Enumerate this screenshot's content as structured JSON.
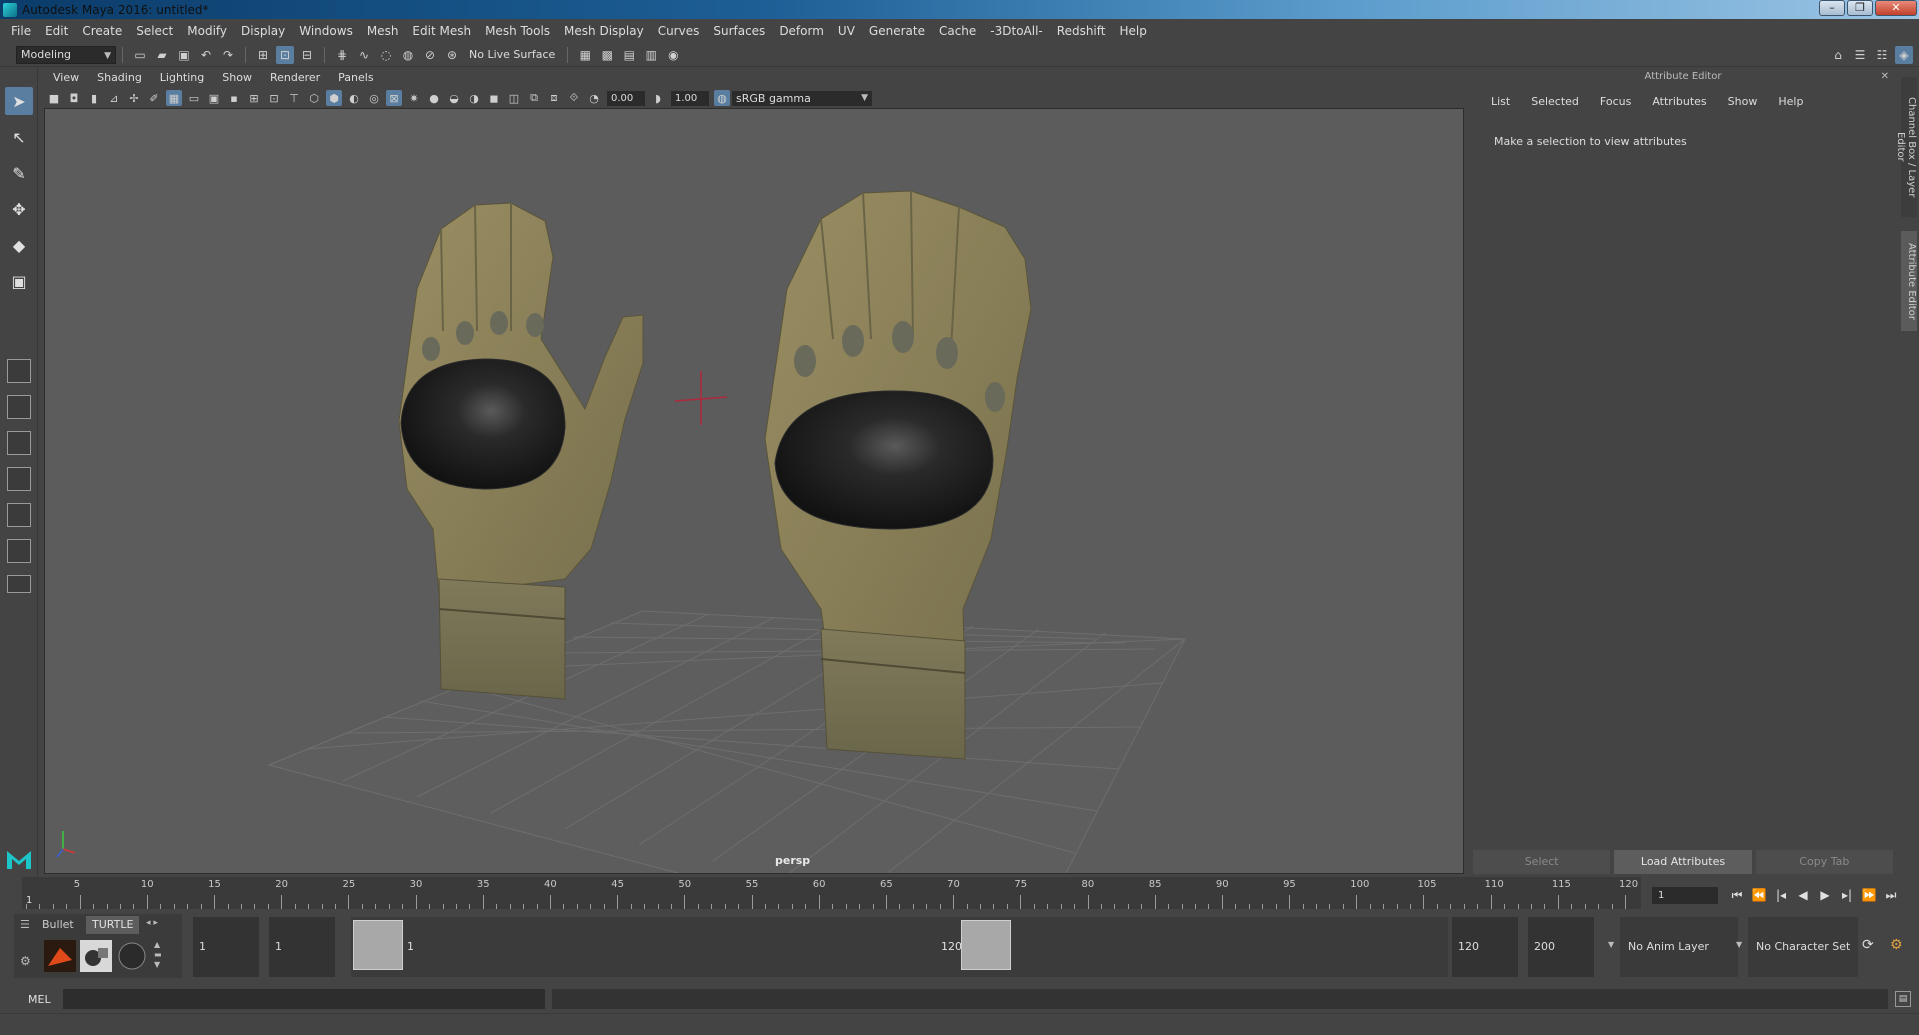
{
  "window": {
    "title": "Autodesk Maya 2016: untitled*",
    "controls": [
      "–",
      "❐",
      "✕"
    ]
  },
  "menubar": [
    "File",
    "Edit",
    "Create",
    "Select",
    "Modify",
    "Display",
    "Windows",
    "Mesh",
    "Edit Mesh",
    "Mesh Tools",
    "Mesh Display",
    "Curves",
    "Surfaces",
    "Deform",
    "UV",
    "Generate",
    "Cache",
    "-3DtoAll-",
    "Redshift",
    "Help"
  ],
  "statusline": {
    "mode": "Modeling",
    "live_surface": "No Live Surface"
  },
  "viewport": {
    "menu": [
      "View",
      "Shading",
      "Lighting",
      "Show",
      "Renderer",
      "Panels"
    ],
    "exposure": "0.00",
    "gamma_value": "1.00",
    "color_space": "sRGB gamma",
    "camera": "persp"
  },
  "attribute_editor": {
    "title": "Attribute Editor",
    "menu": [
      "List",
      "Selected",
      "Focus",
      "Attributes",
      "Show",
      "Help"
    ],
    "message": "Make a selection to view attributes",
    "buttons": {
      "select": "Select",
      "load": "Load Attributes",
      "copy": "Copy Tab"
    },
    "side_tabs": [
      "Channel Box / Layer Editor",
      "Attribute Editor"
    ]
  },
  "timeline": {
    "start": 1,
    "end": 120,
    "ticks": [
      5,
      10,
      15,
      20,
      25,
      30,
      35,
      40,
      45,
      50,
      55,
      60,
      65,
      70,
      75,
      80,
      85,
      90,
      95,
      100,
      105,
      110,
      115,
      120
    ],
    "current_frame_label": "1",
    "current_frame": "1"
  },
  "shelf": {
    "tabs": [
      "Bullet",
      "TURTLE"
    ]
  },
  "range": {
    "start_field": "1",
    "playback_start": "1",
    "handle_start": "1",
    "handle_end": "120",
    "playback_end": "120",
    "end_field": "200",
    "anim_layer": "No Anim Layer",
    "character_set": "No Character Set"
  },
  "commandline": {
    "label": "MEL"
  },
  "colors": {
    "glove_tan": "#8c7f58",
    "knuckle": "#1c1c1c",
    "grid": "#6e6e6e",
    "viewport_bg": "#5c5c5c",
    "accent": "#5a7ea0"
  }
}
